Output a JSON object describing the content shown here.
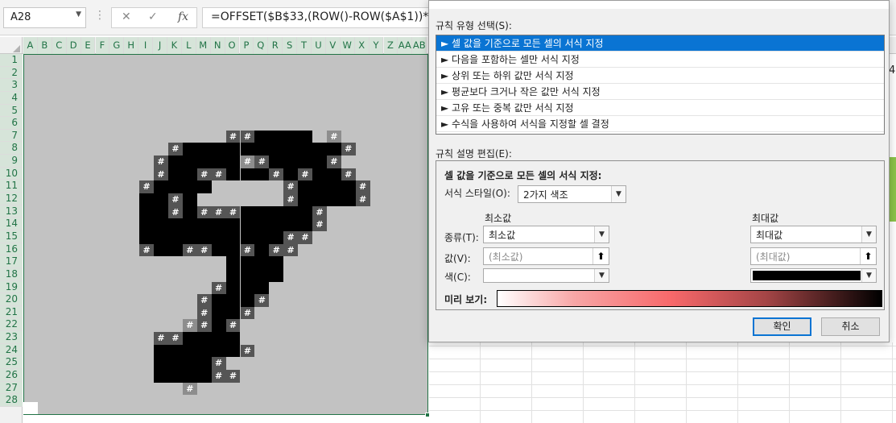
{
  "formula_bar": {
    "name_box": "A28",
    "cancel_icon": "✕",
    "enter_icon": "✓",
    "fx_icon": "fx",
    "formula": "=OFFSET($B$33,(ROW()-ROW($A$1))*28"
  },
  "columns": [
    "A",
    "B",
    "C",
    "D",
    "E",
    "F",
    "G",
    "H",
    "I",
    "J",
    "K",
    "L",
    "M",
    "N",
    "O",
    "P",
    "Q",
    "R",
    "S",
    "T",
    "U",
    "V",
    "W",
    "X",
    "Y",
    "Z",
    "AA",
    "AB"
  ],
  "rows": [
    "1",
    "2",
    "3",
    "4",
    "5",
    "6",
    "7",
    "8",
    "9",
    "10",
    "11",
    "12",
    "13",
    "14",
    "15",
    "16",
    "17",
    "18",
    "19",
    "20",
    "21",
    "22",
    "23",
    "24",
    "25",
    "26",
    "27",
    "28"
  ],
  "hash_char": "#",
  "side_value": "4",
  "dialog": {
    "rule_type_label": "규칙 유형 선택(S):",
    "rule_types": [
      "► 셀 값을 기준으로 모든 셀의 서식 지정",
      "► 다음을 포함하는 셀만 서식 지정",
      "► 상위 또는 하위 값만 서식 지정",
      "► 평균보다 크거나 작은 값만 서식 지정",
      "► 고유 또는 중복 값만 서식 지정",
      "► 수식을 사용하여 서식을 지정할 셀 결정"
    ],
    "edit_label": "규칙 설명 편집(E):",
    "desc_title": "셀 값을 기준으로 모든 셀의 서식 지정:",
    "format_style_label": "서식 스타일(O):",
    "format_style_value": "2가지 색조",
    "min_header": "최소값",
    "max_header": "최대값",
    "type_label": "종류(T):",
    "min_type": "최소값",
    "max_type": "최대값",
    "value_label": "값(V):",
    "min_value_placeholder": "(최소값)",
    "max_value_placeholder": "(최대값)",
    "color_label": "색(C):",
    "min_color": "#ffffff",
    "max_color": "#000000",
    "preview_label": "미리 보기:",
    "ok": "확인",
    "cancel": "취소"
  }
}
